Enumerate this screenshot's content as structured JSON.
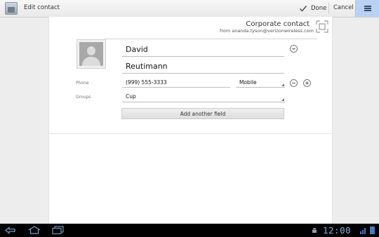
{
  "action_bar": {
    "title": "Edit contact",
    "done_label": "Done",
    "cancel_label": "Cancel"
  },
  "account": {
    "name": "Corporate contact",
    "from": "from ananda.tyson@verizonwireless.com"
  },
  "contact": {
    "first_name": "David",
    "last_name": "Reutimann",
    "phone_label": "Phone",
    "phone_value": "(999) 555-3333",
    "phone_type": "Mobile",
    "groups_label": "Groups",
    "groups_value": "Cup",
    "add_field_label": "Add another field"
  },
  "status_bar": {
    "time": "12:00"
  },
  "colors": {
    "overflow_highlight": "#b9d2f4",
    "clock": "#8fb0d8",
    "battery": "#4a78b8"
  },
  "icons": {
    "app": "contacts-app-icon",
    "done": "check-icon",
    "overflow": "overflow-menu-icon",
    "account": "expand-frame-icon",
    "expand": "chevron-down-icon",
    "remove": "minus-icon",
    "add": "plus-icon",
    "back": "back-icon",
    "home": "home-icon",
    "recent": "recent-apps-icon",
    "debug": "android-debug-icon",
    "signal": "signal-icon",
    "battery": "battery-icon"
  }
}
